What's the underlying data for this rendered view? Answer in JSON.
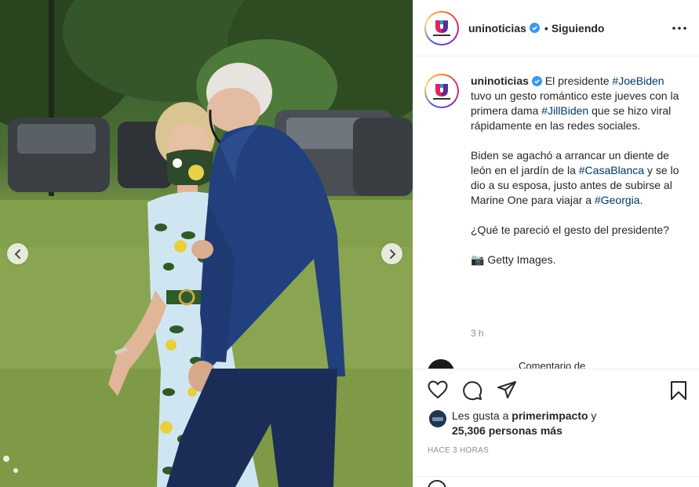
{
  "post": {
    "username": "uninoticias",
    "follow_status": "Siguiendo",
    "separator": "•"
  },
  "caption": {
    "username": "uninoticias",
    "p1_a": "El presidente ",
    "tag_joe": "#JoeBiden",
    "p1_b": " tuvo un gesto romántico este jueves con la primera dama ",
    "tag_jill": "#JillBiden",
    "p1_c": " que se hizo viral rápidamente en las redes sociales.",
    "p2_a": "Biden se agachó a arrancar un diente de león en el jardín de la ",
    "tag_casa": "#CasaBlanca",
    "p2_b": " y se lo dio a su esposa, justo antes de subirse al Marine One para viajar a ",
    "tag_georgia": "#Georgia",
    "p2_c": ".",
    "p3": "¿Qué te pareció el gesto del presidente?",
    "p4_emoji": "📷",
    "p4": " Getty Images.",
    "time": "3 h"
  },
  "likes": {
    "prefix": "Les gusta a ",
    "user": "primerimpacto",
    "conj": " y",
    "count_text": "25,306 personas más"
  },
  "time_ago": "HACE 3 HORAS",
  "comment_stub": "Comentario de",
  "icons": {
    "verified": "verified-badge-icon",
    "more": "more-options-icon",
    "like": "heart-icon",
    "comment": "comment-bubble-icon",
    "share": "paper-plane-icon",
    "save": "bookmark-icon",
    "prev": "chevron-left-icon",
    "next": "chevron-right-icon"
  },
  "colors": {
    "verified": "#3897f0",
    "hashtag": "#00376b",
    "muted": "#8e8e8e"
  }
}
